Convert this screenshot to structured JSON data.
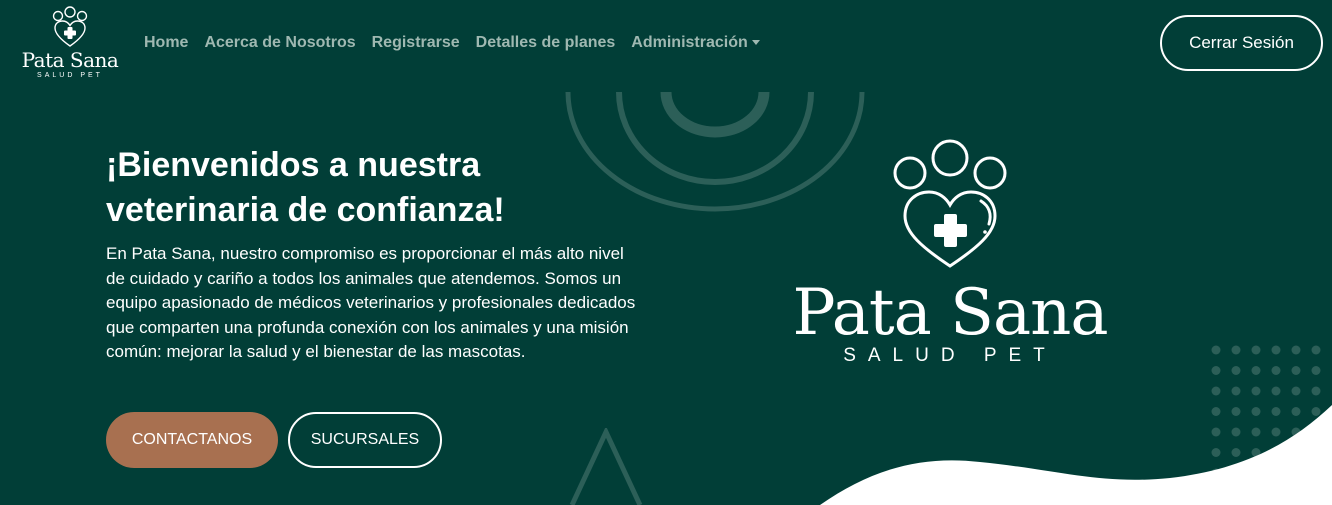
{
  "brand": {
    "name": "Pata Sana",
    "tagline": "SALUD PET",
    "logo_icon": "paw-heart-cross-icon"
  },
  "nav": {
    "items": [
      {
        "label": "Home"
      },
      {
        "label": "Acerca de Nosotros"
      },
      {
        "label": "Registrarse"
      },
      {
        "label": "Detalles de planes"
      },
      {
        "label": "Administración",
        "dropdown": true
      }
    ],
    "logout_label": "Cerrar Sesión"
  },
  "hero": {
    "title": "¡Bienvenidos a nuestra veterinaria de confianza!",
    "text": "En Pata Sana, nuestro compromiso es proporcionar el más alto nivel de cuidado y cariño a todos los animales que atendemos. Somos un equipo apasionado de médicos veterinarios y profesionales dedicados que comparten una profunda conexión con los animales y una misión común: mejorar la salud y el bienestar de las mascotas.",
    "primary_button": "CONTACTANOS",
    "secondary_button": "SUCURSALES"
  },
  "colors": {
    "background": "#013e37",
    "nav_link": "#9fb8b1",
    "accent_button": "#a87050",
    "text": "#ffffff"
  }
}
